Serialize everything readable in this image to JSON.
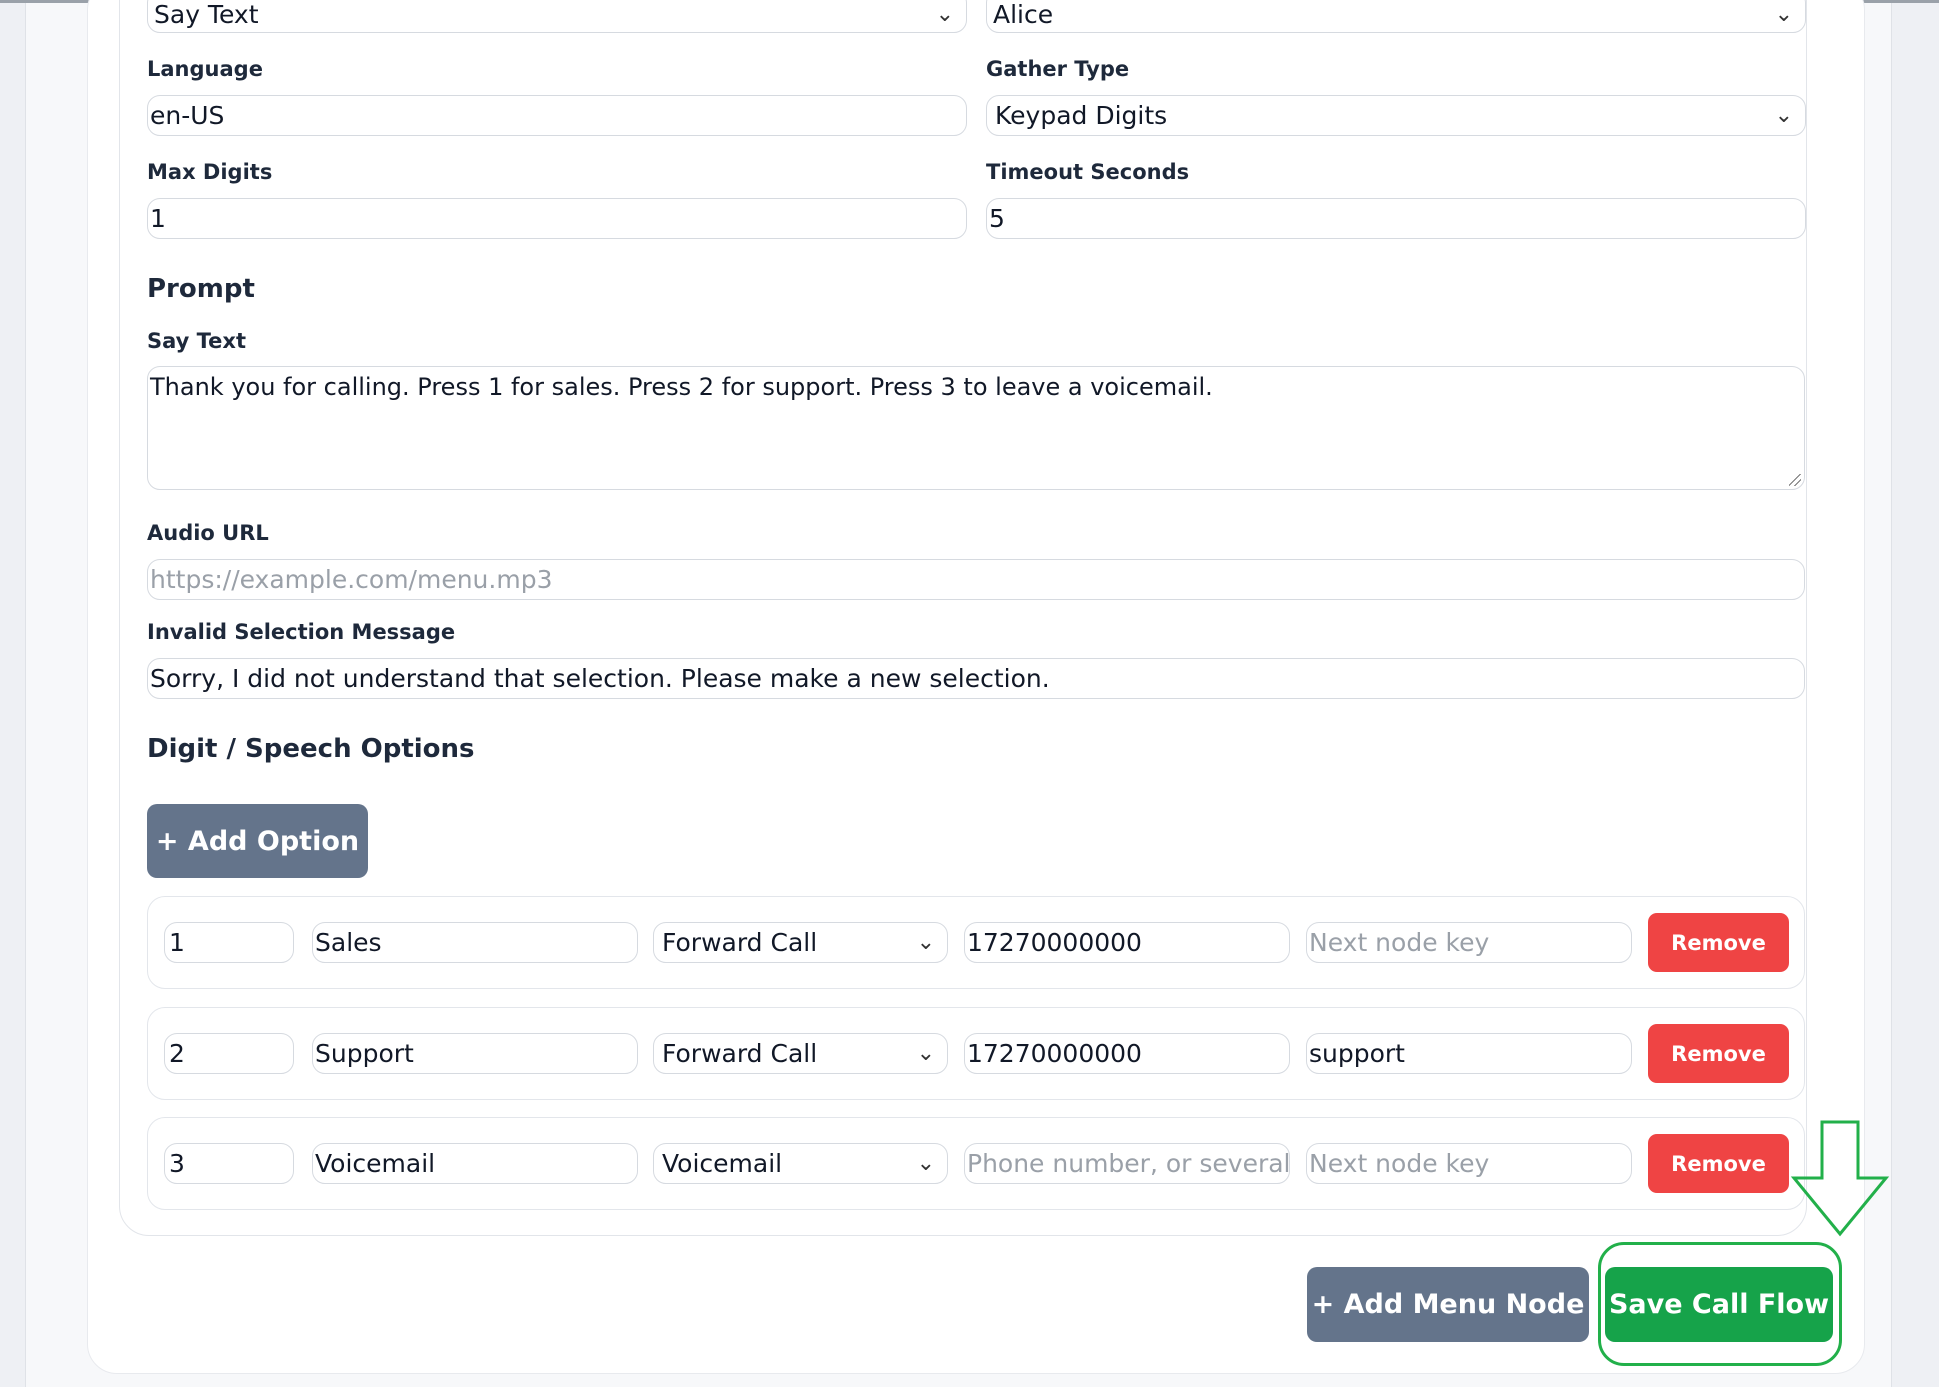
{
  "top_selects": {
    "prompt_type": "Say Text",
    "voice": "Alice"
  },
  "fields": {
    "language": {
      "label": "Language",
      "value": "en-US"
    },
    "gather_type": {
      "label": "Gather Type",
      "value": "Keypad Digits"
    },
    "max_digits": {
      "label": "Max Digits",
      "value": "1"
    },
    "timeout_seconds": {
      "label": "Timeout Seconds",
      "value": "5"
    }
  },
  "prompt": {
    "heading": "Prompt",
    "say_text_label": "Say Text",
    "say_text_value": "Thank you for calling. Press 1 for sales. Press 2 for support. Press 3 to leave a voicemail.",
    "audio_url_label": "Audio URL",
    "audio_url_placeholder": "https://example.com/menu.mp3",
    "invalid_label": "Invalid Selection Message",
    "invalid_value": "Sorry, I did not understand that selection. Please make a new selection."
  },
  "options": {
    "heading": "Digit / Speech Options",
    "add_option_label": "+ Add Option",
    "remove_label": "Remove",
    "rows": [
      {
        "digit": "1",
        "name": "Sales",
        "action": "Forward Call",
        "target": "17270000000",
        "target_placeholder": "",
        "next": "",
        "next_placeholder": "Next node key"
      },
      {
        "digit": "2",
        "name": "Support",
        "action": "Forward Call",
        "target": "17270000000",
        "target_placeholder": "",
        "next": "support",
        "next_placeholder": ""
      },
      {
        "digit": "3",
        "name": "Voicemail",
        "action": "Voicemail",
        "target": "",
        "target_placeholder": "Phone number, or several se",
        "next": "",
        "next_placeholder": "Next node key"
      }
    ]
  },
  "footer": {
    "add_menu_node_label": "+ Add Menu Node",
    "save_label": "Save Call Flow"
  },
  "colors": {
    "gray_button": "#64748b",
    "remove_button": "#ef4444",
    "save_button": "#16a34a",
    "annotation": "#22b04a"
  },
  "icons": {
    "select_chevron": "chevron-down-icon",
    "annotation_arrow": "arrow-down-icon"
  }
}
